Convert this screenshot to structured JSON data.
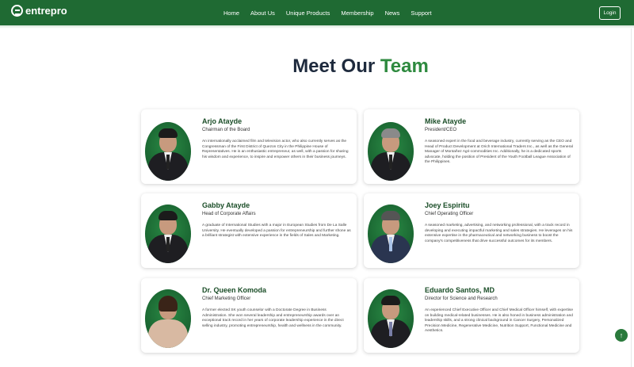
{
  "header": {
    "logo_text": "entrepro",
    "nav": [
      "Home",
      "About Us",
      "Unique Products",
      "Membership",
      "News",
      "Support"
    ],
    "login_label": "Login"
  },
  "title": {
    "part1": "Meet Our",
    "part2": "Team"
  },
  "team": [
    {
      "name": "Arjo Atayde",
      "role": "Chairman of the Board",
      "desc": "An internationally acclaimed film and television actor, who also currently serves as the Congressman of the First District of Quezon City in the Philippine House of Representatives. He is an enthusiastic entrepreneur, as well, with a passion for sharing his wisdom and experience, to inspire and empower others in their business journeys."
    },
    {
      "name": "Mike Atayde",
      "role": "President/CEO",
      "desc": "A seasoned expert in the food and beverage industry, currently serving as the CEO and Head of Product Development at Orich International Traders Inc., as well as the General Manager of Montañez Agri-commodities Inc. Additionally, he is a dedicated sports advocate, holding the position of President of the Youth Football League Association of the Philippines."
    },
    {
      "name": "Gabby Atayde",
      "role": "Head of Corporate Affairs",
      "desc": "A graduate of International Studies with a major in European Studies from De La Salle University. He eventually developed a passion for entrepreneurship and further shone as a brilliant strategist with extensive experience in the fields of Sales and Marketing."
    },
    {
      "name": "Joey Espiritu",
      "role": "Chief Operating Officer",
      "desc": "A seasoned marketing, advertising, and networking professional, with a track record in developing and executing impactful marketing and sales strategies. He leverages on his extensive expertise in the pharmaceutical and networking business to boost the company's competitiveness that drive successful outcomes for its members."
    },
    {
      "name": "Dr. Queen Komoda",
      "role": "Chief Marketing Officer",
      "desc": "A former elected SK youth counselor with a Doctorate Degree in Business Administration. She won several leadership and entrepreneurship awards over an exceptional track record in her years of corporate leadership experience in the direct selling industry, promoting entrepreneurship, health and wellness in the community."
    },
    {
      "name": "Eduardo Santos, MD",
      "role": "Director for Science and Research",
      "desc": "An experienced Chief Executive Officer and Chief Medical Officer himself, with expertise on building medical-related businesses. He is also honed in business administration and leadership skills, and a strong clinical background in Cancer Surgery, Personalized Precision Medicine, Regenerative Medicine, Nutrition Support, Functional Medicine and Aesthetics."
    }
  ],
  "scroll_top_icon": "arrow-up-icon"
}
